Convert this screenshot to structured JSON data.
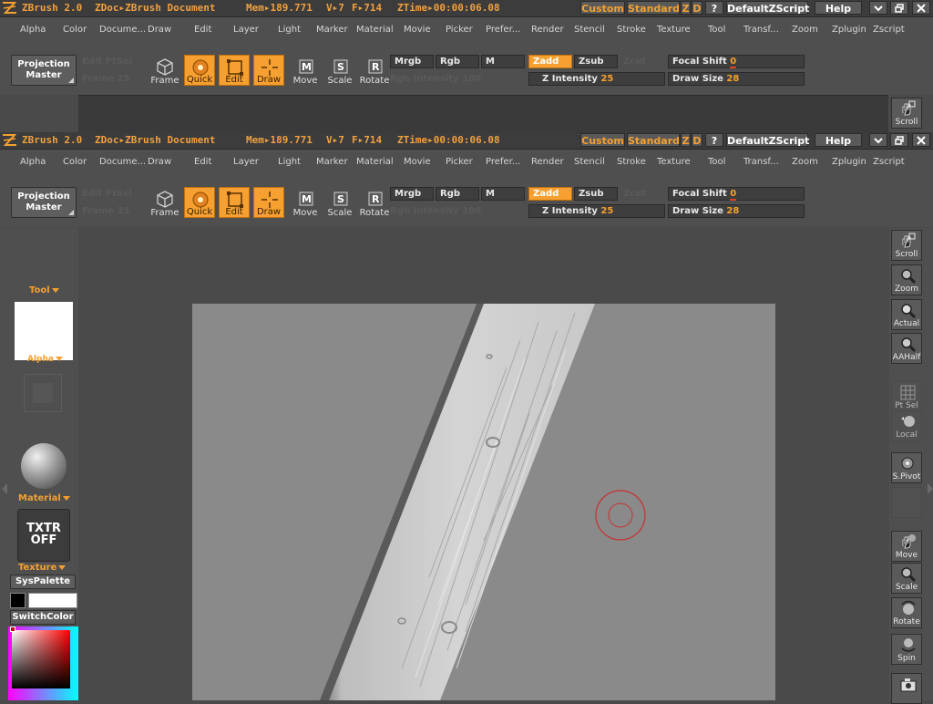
{
  "titlebar": {
    "app_name": "ZBrush 2.0",
    "doc_title": "ZDoc▸ZBrush Document",
    "mem": "Mem▸189.771",
    "v": "V▸7",
    "f": "F▸714",
    "ztime": "ZTime▸00:00:06.08",
    "buttons": {
      "custom": "Custom",
      "standard": "Standard",
      "z": "Z",
      "d": "D",
      "question": "?",
      "script": "DefaultZScript",
      "help": "Help"
    },
    "window_icons": [
      "minimize-icon",
      "restore-icon",
      "close-icon"
    ]
  },
  "menu": [
    "Alpha",
    "Color",
    "Docume...",
    "Draw",
    "Edit",
    "Layer",
    "Light",
    "Marker",
    "Material",
    "Movie",
    "Picker",
    "Prefer...",
    "Render",
    "Stencil",
    "Stroke",
    "Texture",
    "Tool",
    "Transf...",
    "Zoom",
    "Zplugin",
    "Zscript"
  ],
  "toolbar": {
    "projection_master": [
      "Projection",
      "Master"
    ],
    "ghost_left_top": "Edit  PtSel",
    "ghost_left_bottom": "Frame  25",
    "tools": [
      {
        "label": "Frame",
        "icon": "cube-icon",
        "active": false
      },
      {
        "label": "Quick",
        "icon": "quick-sphere-icon",
        "active": true
      },
      {
        "label": "Edit",
        "icon": "edit-frame-icon",
        "active": true
      },
      {
        "label": "Draw",
        "icon": "draw-crosshair-icon",
        "active": true
      },
      {
        "label": "Move",
        "icon": "move-icon",
        "active": false
      },
      {
        "label": "Scale",
        "icon": "scale-icon",
        "active": false
      },
      {
        "label": "Rotate",
        "icon": "rotate-icon",
        "active": false
      }
    ],
    "mrgb": "Mrgb",
    "rgb": "Rgb",
    "m": "M",
    "zadd": "Zadd",
    "zsub": "Zsub",
    "zcut_ghost": "Zcut",
    "rgb_intensity_ghost": "Rgb Intensity 100",
    "z_intensity_label": "Z Intensity",
    "z_intensity_value": "25",
    "focal_shift_label": "Focal Shift",
    "focal_shift_value": "0",
    "draw_size_label": "Draw Size",
    "draw_size_value": "28"
  },
  "right_shelf": [
    {
      "label": "Scroll",
      "icon": "scroll-hand-icon"
    },
    {
      "label": "Zoom",
      "icon": "zoom-magnifier-icon"
    },
    {
      "label": "Actual",
      "icon": "actual-magnifier-icon"
    },
    {
      "label": "AAHalf",
      "icon": "aahalf-magnifier-icon"
    },
    {
      "label": "Pt Sel",
      "icon": "grid-icon"
    },
    {
      "label": "Local",
      "icon": "local-sphere-icon"
    },
    {
      "label": "S.Pivot",
      "icon": "spivot-icon"
    },
    {
      "label": "",
      "icon": "blank-icon"
    },
    {
      "label": "Move",
      "icon": "move-hand-icon"
    },
    {
      "label": "Scale",
      "icon": "scale-magnifier-icon"
    },
    {
      "label": "Rotate",
      "icon": "rotate-sphere-icon"
    },
    {
      "label": "Spin",
      "icon": "spin-icon"
    },
    {
      "label": "",
      "icon": "camera-icon"
    }
  ],
  "left_palette": {
    "tool_label": "Tool",
    "alpha_label": "Alpha",
    "material_label": "Material",
    "texture_label": "Texture",
    "txtr_off": [
      "TXTR",
      "OFF"
    ],
    "syspalette": "SysPalette",
    "switchcolor": "SwitchColor",
    "main_color": "#000000",
    "secondary_color": "#ffffff"
  },
  "colors": {
    "accent": "#f5a030",
    "panel": "#4f4f4f",
    "document_bg": "#8a8a8a",
    "brush_cursor": "#c83030"
  }
}
